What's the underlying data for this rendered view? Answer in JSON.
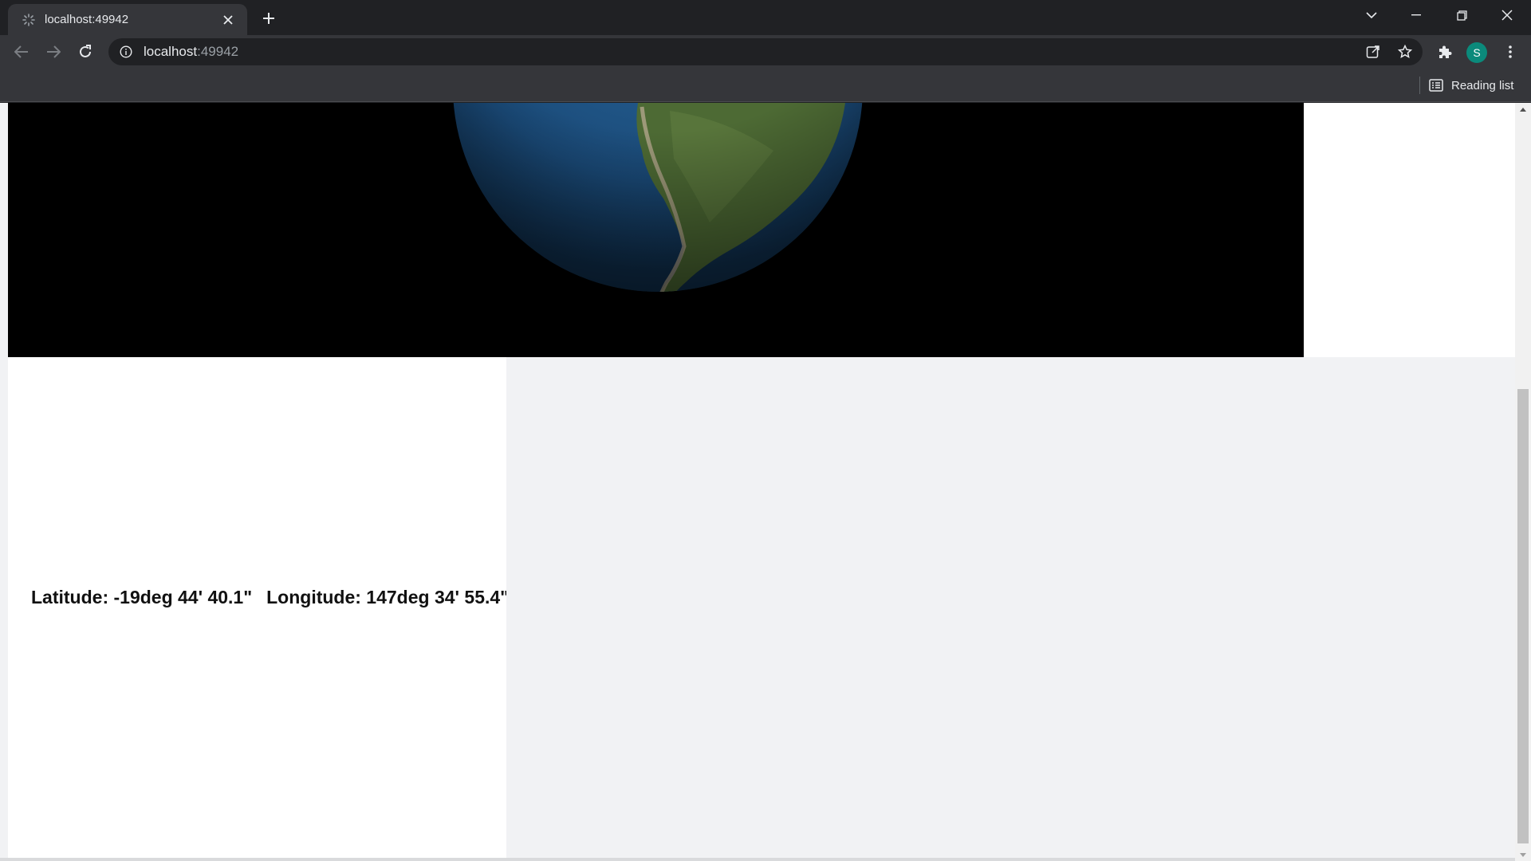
{
  "tab": {
    "title": "localhost:49942"
  },
  "omnibox": {
    "host": "localhost",
    "port": ":49942"
  },
  "profile": {
    "initial": "S",
    "color": "#0b8a7b"
  },
  "bookmarks": {
    "reading_list_label": "Reading list"
  },
  "coordinates": {
    "latitude": "Latitude: -19deg 44' 40.1\"",
    "longitude": "Longitude: 147deg 34' 55.4\""
  },
  "icons": {
    "favicon": "loading-favicon-icon",
    "close": "close-icon",
    "new_tab": "plus-icon",
    "back": "back-arrow-icon",
    "forward": "forward-arrow-icon",
    "reload": "reload-icon",
    "info": "info-icon",
    "share": "share-icon",
    "bookmark": "star-icon",
    "extensions": "puzzle-icon",
    "menu": "kebab-menu-icon",
    "reading_list": "reading-list-icon"
  },
  "colors": {
    "chrome_dark": "#202124",
    "toolbar": "#35363a",
    "canvas": "#000000",
    "page_gray": "#f1f2f4",
    "ocean": "#1d4f7c",
    "land": "#4d6a34"
  }
}
